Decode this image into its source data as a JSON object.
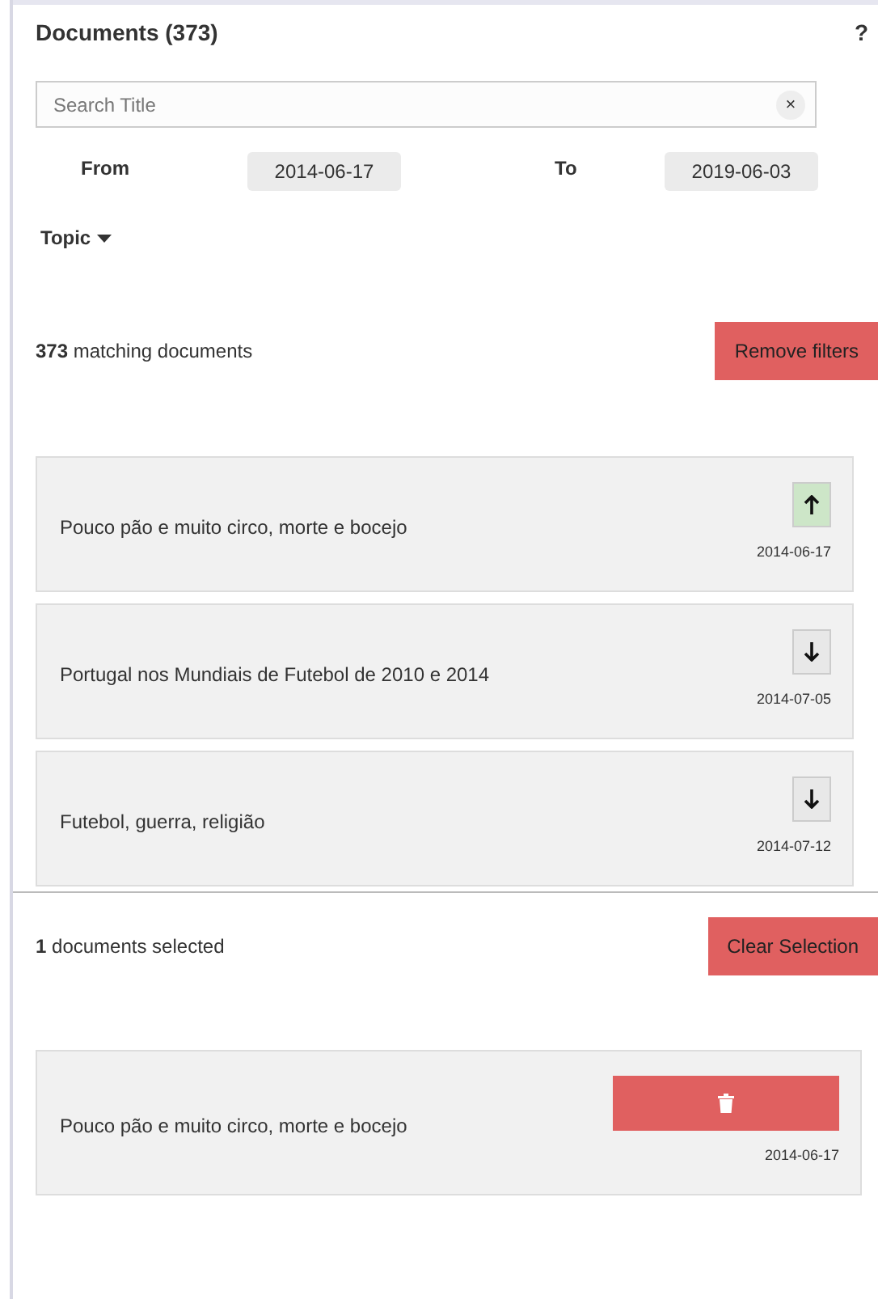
{
  "panel": {
    "title": "Documents (373)",
    "help": "?"
  },
  "search": {
    "placeholder": "Search Title",
    "clear": "×"
  },
  "dates": {
    "from_label": "From",
    "from": "2014-06-17",
    "to_label": "To",
    "to": "2019-06-03"
  },
  "topic": {
    "label": "Topic"
  },
  "results": {
    "summary": "**373** matching documents",
    "button": "Remove filters"
  },
  "documents": [
    {
      "title": "Pouco pão e muito circo, morte e bocejo",
      "date": "2014-06-17",
      "selected": true
    },
    {
      "title": "Portugal nos Mundiais de Futebol de 2010 e 2014",
      "date": "2014-07-05",
      "selected": false
    },
    {
      "title": "Futebol, guerra, religião",
      "date": "2014-07-12",
      "selected": false
    }
  ],
  "selection": {
    "summary": "**1** documents selected",
    "button": "Clear Selection"
  },
  "selected_documents": [
    {
      "title": "Pouco pão e muito circo, morte e bocejo",
      "date": "2014-06-17"
    }
  ]
}
